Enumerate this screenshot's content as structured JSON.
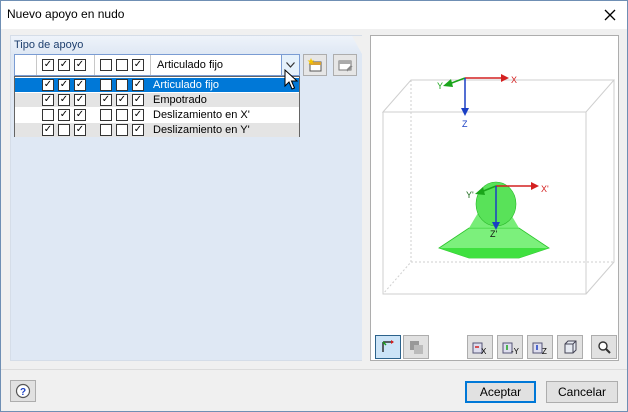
{
  "window": {
    "title": "Nuevo apoyo en nudo"
  },
  "support_type": {
    "group_title": "Tipo de apoyo",
    "selected": {
      "label": "Articulado fijo",
      "group1": [
        true,
        true,
        true
      ],
      "group2": [
        false,
        false,
        true
      ]
    },
    "options": [
      {
        "label": "Articulado fijo",
        "group1": [
          true,
          true,
          true
        ],
        "group2": [
          false,
          false,
          true
        ],
        "highlighted": true
      },
      {
        "label": "Empotrado",
        "group1": [
          true,
          true,
          true
        ],
        "group2": [
          true,
          true,
          true
        ],
        "highlighted": false
      },
      {
        "label": "Deslizamiento en X'",
        "group1": [
          false,
          true,
          true
        ],
        "group2": [
          false,
          false,
          true
        ],
        "highlighted": false
      },
      {
        "label": "Deslizamiento en Y'",
        "group1": [
          true,
          false,
          true
        ],
        "group2": [
          false,
          false,
          true
        ],
        "highlighted": false
      }
    ]
  },
  "preview": {
    "global_axes": {
      "x": "X",
      "y": "Y",
      "z": "Z"
    },
    "local_axes": {
      "x": "X'",
      "y": "Y'",
      "z": "Z'"
    },
    "colors": {
      "x_axis": "#d42020",
      "y_axis": "#1aa51a",
      "z_axis": "#1a3fc4",
      "support": "#33e633"
    }
  },
  "buttons": {
    "ok": "Aceptar",
    "cancel": "Cancelar"
  },
  "icons": {
    "close": "close-icon",
    "dropdown": "chevron-down-icon",
    "help": "help-icon"
  }
}
